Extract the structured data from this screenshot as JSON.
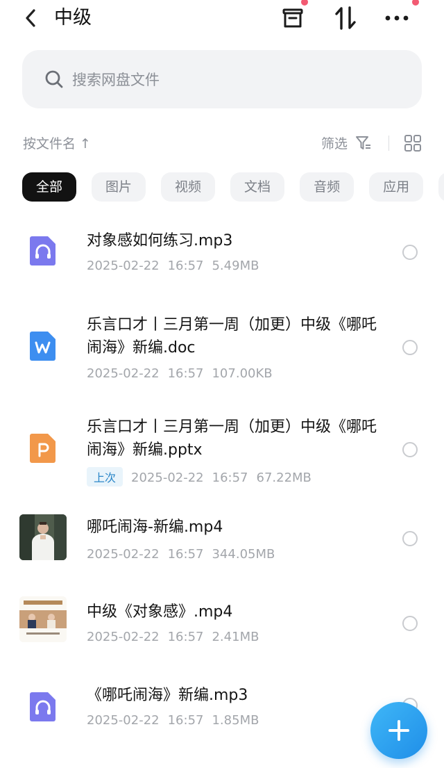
{
  "header": {
    "title": "中级",
    "back_icon": "chevron-left-icon",
    "actions": [
      "archive-icon",
      "transfer-icon",
      "more-icon"
    ]
  },
  "search": {
    "placeholder": "搜索网盘文件"
  },
  "sortbar": {
    "sort_label": "按文件名 ↑",
    "filter_label": "筛选"
  },
  "filters": [
    "全部",
    "图片",
    "视频",
    "文档",
    "音频",
    "应用"
  ],
  "active_filter": 0,
  "files": [
    {
      "name": "对象感如何练习.mp3",
      "date": "2025-02-22",
      "time": "16:57",
      "size": "5.49MB",
      "type": "audio",
      "badge": ""
    },
    {
      "name": "乐言口才丨三月第一周（加更）中级《哪吒闹海》新编.doc",
      "date": "2025-02-22",
      "time": "16:57",
      "size": "107.00KB",
      "type": "word",
      "badge": ""
    },
    {
      "name": "乐言口才丨三月第一周（加更）中级《哪吒闹海》新编.pptx",
      "date": "2025-02-22",
      "time": "16:57",
      "size": "67.22MB",
      "type": "ppt",
      "badge": "上次"
    },
    {
      "name": "哪吒闹海-新编.mp4",
      "date": "2025-02-22",
      "time": "16:57",
      "size": "344.05MB",
      "type": "video-thumb",
      "badge": ""
    },
    {
      "name": "中级《对象感》.mp4",
      "date": "2025-02-22",
      "time": "16:57",
      "size": "2.41MB",
      "type": "video-thumb2",
      "badge": ""
    },
    {
      "name": "《哪吒闹海》新编.mp3",
      "date": "2025-02-22",
      "time": "16:57",
      "size": "1.85MB",
      "type": "audio",
      "badge": ""
    }
  ],
  "fab": {
    "icon": "plus-icon"
  },
  "colors": {
    "audio": "#7b79ee",
    "word": "#3d8ef0",
    "ppt": "#f2984a",
    "accent": "#1f8ee8"
  }
}
